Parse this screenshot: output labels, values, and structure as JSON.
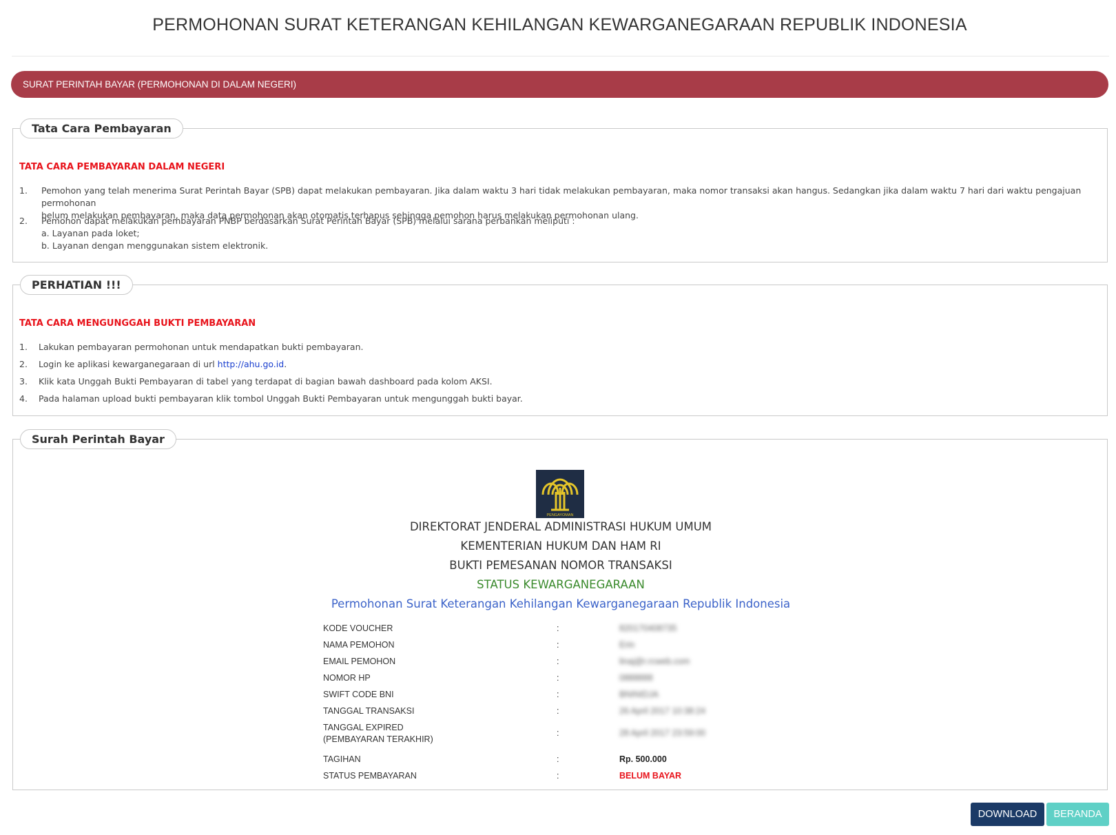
{
  "page_title": "PERMOHONAN SURAT KETERANGAN KEHILANGAN KEWARGANEGARAAN REPUBLIK INDONESIA",
  "banner": "SURAT PERINTAH BAYAR (PERMOHONAN DI DALAM NEGERI)",
  "tata_cara": {
    "legend": "Tata Cara Pembayaran",
    "heading": "TATA CARA PEMBAYARAN DALAM NEGERI",
    "items": [
      {
        "num": "1.",
        "lines": [
          "Pemohon yang telah menerima Surat Perintah Bayar (SPB) dapat melakukan pembayaran. Jika dalam waktu 3 hari tidak melakukan pembayaran, maka nomor transaksi akan hangus. Sedangkan jika dalam waktu 7 hari dari waktu pengajuan permohonan",
          "belum melakukan pembayaran, maka data permohonan akan otomatis terhapus sehingga pemohon harus melakukan permohonan ulang."
        ]
      },
      {
        "num": "2.",
        "lines": [
          "Pemohon dapat melakukan pembayaran PNBP berdasarkan Surat Perintah Bayar (SPB) melalui sarana perbankan meliputi :",
          "a. Layanan pada loket;",
          "b. Layanan dengan menggunakan sistem elektronik."
        ]
      }
    ]
  },
  "perhatian": {
    "legend": "PERHATIAN !!!",
    "heading": "TATA CARA MENGUNGGAH BUKTI PEMBAYARAN",
    "items": [
      {
        "num": "1.",
        "text": "Lakukan pembayaran permohonan untuk mendapatkan bukti pembayaran."
      },
      {
        "num": "2.",
        "text_before": "Login ke aplikasi kewarganegaraan di url ",
        "link": "http://ahu.go.id",
        "text_after": "."
      },
      {
        "num": "3.",
        "text": "Klik kata Unggah Bukti Pembayaran di tabel yang terdapat di bagian bawah dashboard pada kolom AKSI."
      },
      {
        "num": "4.",
        "text": "Pada halaman upload bukti pembayaran klik tombol Unggah Bukti Pembayaran untuk mengunggah bukti bayar."
      }
    ]
  },
  "spb": {
    "legend": "Surah Perintah Bayar",
    "logo_text": "PENGAYOMAN",
    "line1": "DIREKTORAT JENDERAL ADMINISTRASI HUKUM UMUM",
    "line2": "KEMENTERIAN HUKUM DAN HAM RI",
    "line3": "BUKTI PEMESANAN NOMOR TRANSAKSI",
    "status_title": "STATUS KEWARGANEGARAAN",
    "service_title": "Permohonan Surat Keterangan Kehilangan Kewarganegaraan Republik Indonesia",
    "rows": [
      {
        "label": "KODE VOUCHER",
        "label2": "",
        "sep": ":",
        "value": "820170408735",
        "blurred": true
      },
      {
        "label": "NAMA PEMOHON",
        "label2": "",
        "sep": ":",
        "value": "Erin",
        "blurred": true
      },
      {
        "label": "EMAIL PEMOHON",
        "label2": "",
        "sep": ":",
        "value": "linaj@r.rcweb.com",
        "blurred": true
      },
      {
        "label": "NOMOR HP",
        "label2": "",
        "sep": ":",
        "value": "0888888",
        "blurred": true
      },
      {
        "label": "SWIFT CODE BNI",
        "label2": "",
        "sep": ":",
        "value": "BNINIDJA",
        "blurred": true
      },
      {
        "label": "TANGGAL TRANSAKSI",
        "label2": "",
        "sep": ":",
        "value": "26 April 2017 10:38:24",
        "blurred": true
      },
      {
        "label": "TANGGAL EXPIRED",
        "label2": "(PEMBAYARAN TERAKHIR)",
        "sep": ":",
        "value": "28 April 2017 23:59:00",
        "blurred": true
      },
      {
        "label": "TAGIHAN",
        "label2": "",
        "sep": ":",
        "value": "Rp. 500.000",
        "blurred": false
      },
      {
        "label": "STATUS PEMBAYARAN",
        "label2": "",
        "sep": ":",
        "value": "BELUM BAYAR",
        "blurred": false
      }
    ]
  },
  "buttons": {
    "download": "DOWNLOAD",
    "beranda": "BERANDA"
  },
  "colors": {
    "banner": "#a83c48",
    "red": "#e8131b",
    "green": "#3a8a2c",
    "blue": "#3c63c9",
    "download": "#1b3a66",
    "beranda": "#5fd0c6"
  }
}
